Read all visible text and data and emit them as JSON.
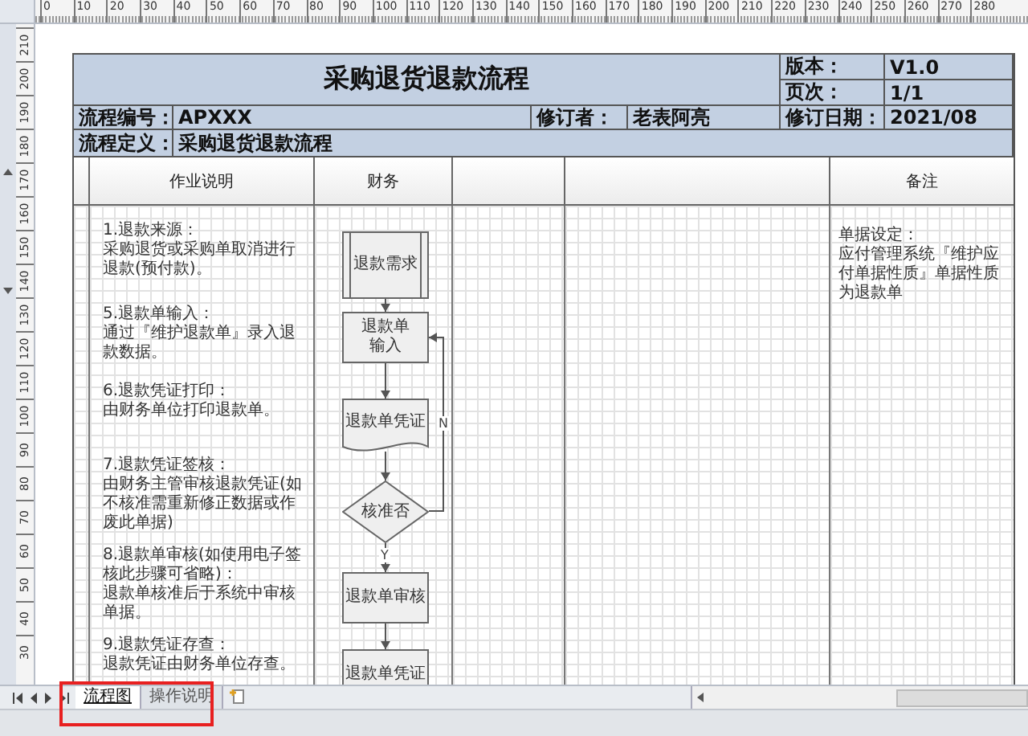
{
  "rulers": {
    "horizontal": [
      "0",
      "10",
      "20",
      "30",
      "40",
      "50",
      "60",
      "70",
      "80",
      "90",
      "100",
      "110",
      "120",
      "130",
      "140",
      "150",
      "160",
      "170",
      "180",
      "190",
      "200",
      "210",
      "220",
      "230",
      "240",
      "250",
      "260",
      "270",
      "280"
    ],
    "vertical": [
      "210",
      "200",
      "190",
      "180",
      "170",
      "160",
      "150",
      "140",
      "130",
      "120",
      "110",
      "100",
      "90",
      "80",
      "70",
      "60",
      "50",
      "40",
      "30"
    ]
  },
  "header": {
    "title": "采购退货退款流程",
    "version_label": "版本：",
    "version": "V1.0",
    "page_label": "页次：",
    "page": "1/1",
    "process_no_label": "流程编号：",
    "process_no": "APXXX",
    "reviser_label": "修订者：",
    "reviser": "老表阿亮",
    "revision_date_label": "修订日期：",
    "revision_date": "2021/08",
    "definition_label": "流程定义：",
    "definition": "采购退货退款流程"
  },
  "lane_headers": [
    "作业说明",
    "财务"
  ],
  "notes_header": "备注",
  "steps": [
    {
      "title": "1.退款来源：",
      "text": "采购退货或采购单取消进行退款(预付款)。"
    },
    {
      "title": "5.退款单输入：",
      "text": "通过『维护退款单』录入退款数据。"
    },
    {
      "title": "6.退款凭证打印：",
      "text": "由财务单位打印退款单。"
    },
    {
      "title": "7.退款凭证签核：",
      "text": "由财务主管审核退款凭证(如不核准需重新修正数据或作废此单据)"
    },
    {
      "title": "8.退款单审核(如使用电子签核此步骤可省略)：",
      "text": "退款单核准后于系统中审核单据。"
    },
    {
      "title": "9.退款凭证存查：",
      "text": "退款凭证由财务单位存查。"
    }
  ],
  "flowchart": {
    "nodes": [
      {
        "kind": "predefined",
        "lines": [
          "退款需求"
        ]
      },
      {
        "kind": "process",
        "lines": [
          "退款单",
          "输入"
        ]
      },
      {
        "kind": "document",
        "lines": [
          "退款单凭证"
        ]
      },
      {
        "kind": "decision",
        "lines": [
          "核准否"
        ]
      },
      {
        "kind": "process",
        "lines": [
          "退款单审核"
        ]
      },
      {
        "kind": "process",
        "lines": [
          "退款单凭证"
        ]
      }
    ],
    "yes_label": "Y",
    "no_label": "N"
  },
  "notes": {
    "title": "单据设定：",
    "text": "应付管理系统『维护应付单据性质』单据性质为退款单"
  },
  "sheet_tabs": [
    {
      "label": "流程图",
      "selected": true
    },
    {
      "label": "操作说明",
      "selected": false
    }
  ]
}
